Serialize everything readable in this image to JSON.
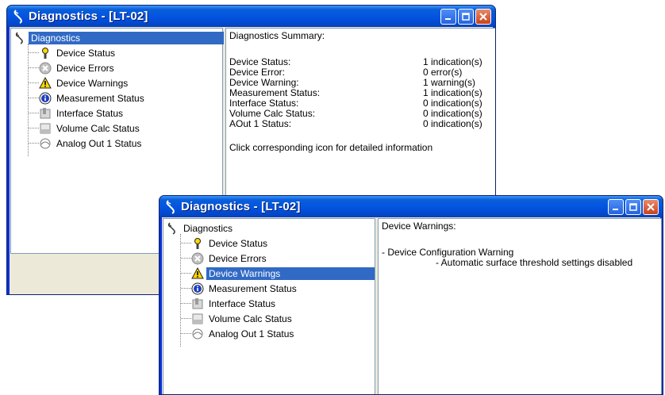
{
  "win1": {
    "title": "Diagnostics - [LT-02]",
    "tree": {
      "root": "Diagnostics",
      "items": [
        {
          "label": "Device Status",
          "icon": "status-icon"
        },
        {
          "label": "Device Errors",
          "icon": "error-icon"
        },
        {
          "label": "Device Warnings",
          "icon": "warning-icon"
        },
        {
          "label": "Measurement Status",
          "icon": "info-icon"
        },
        {
          "label": "Interface Status",
          "icon": "interface-icon"
        },
        {
          "label": "Volume Calc Status",
          "icon": "volume-icon"
        },
        {
          "label": "Analog Out 1 Status",
          "icon": "analog-icon"
        }
      ]
    },
    "summary": {
      "heading": "Diagnostics Summary:",
      "rows": [
        {
          "label": "Device Status:",
          "value": "1 indication(s)"
        },
        {
          "label": "Device Error:",
          "value": "0 error(s)"
        },
        {
          "label": "Device Warning:",
          "value": "1 warning(s)"
        },
        {
          "label": "Measurement Status:",
          "value": "1 indication(s)"
        },
        {
          "label": "Interface Status:",
          "value": "0 indication(s)"
        },
        {
          "label": "Volume Calc Status:",
          "value": "0 indication(s)"
        },
        {
          "label": "AOut 1 Status:",
          "value": "0 indication(s)"
        }
      ],
      "footer": "Click corresponding icon for detailed information"
    }
  },
  "win2": {
    "title": "Diagnostics - [LT-02]",
    "tree": {
      "root": "Diagnostics",
      "items": [
        {
          "label": "Device Status",
          "icon": "status-icon"
        },
        {
          "label": "Device Errors",
          "icon": "error-icon"
        },
        {
          "label": "Device Warnings",
          "icon": "warning-icon"
        },
        {
          "label": "Measurement Status",
          "icon": "info-icon"
        },
        {
          "label": "Interface Status",
          "icon": "interface-icon"
        },
        {
          "label": "Volume Calc Status",
          "icon": "volume-icon"
        },
        {
          "label": "Analog Out 1 Status",
          "icon": "analog-icon"
        }
      ],
      "selected": "Device Warnings"
    },
    "warnings": {
      "heading": "Device Warnings:",
      "item": "- Device Configuration Warning",
      "detail": "- Automatic surface threshold settings disabled"
    }
  },
  "colors": {
    "title_bar": "#0353e0",
    "selection": "#316ac5",
    "window_face": "#ece9d8",
    "close_button": "#c8431c",
    "warning_yellow": "#ffd800"
  }
}
